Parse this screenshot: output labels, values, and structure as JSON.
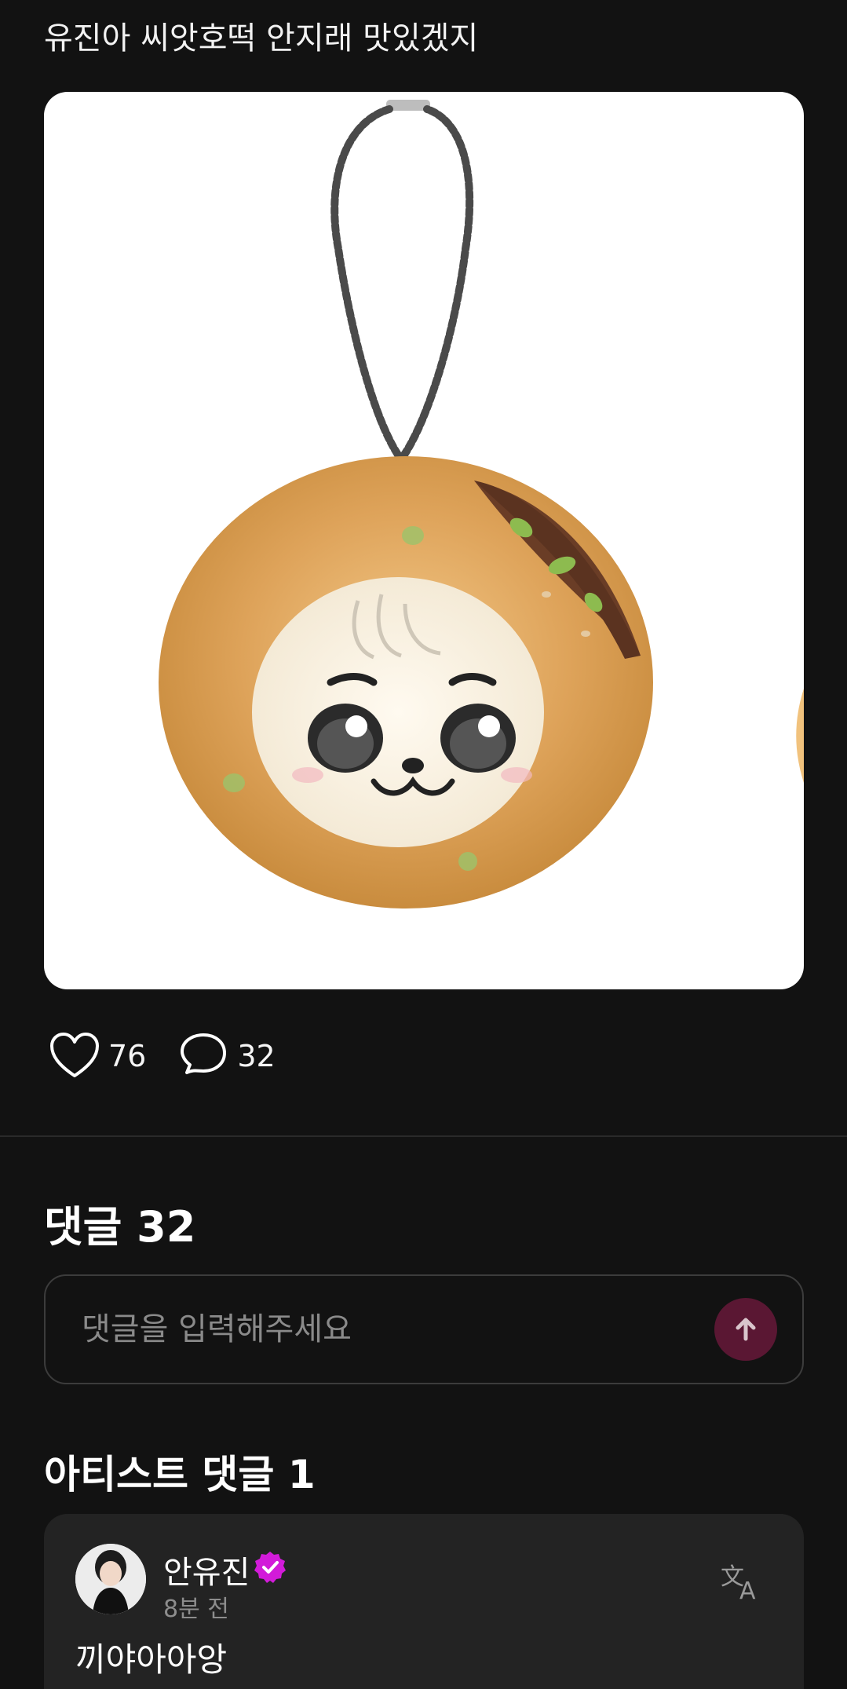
{
  "post": {
    "text": "유진아 씨앗호떡 안지래 맛있겠지",
    "likes": "76",
    "comments": "32"
  },
  "comments_section": {
    "title": "댓글 32",
    "input_placeholder": "댓글을 입력해주세요"
  },
  "artist_section": {
    "title": "아티스트 댓글 1",
    "comment": {
      "author": "안유진",
      "time": "8분 전",
      "text": "끼야아아앙"
    }
  },
  "colors": {
    "background": "#121212",
    "card": "#232323",
    "send_button": "#5a1733",
    "verified_badge": "#d21bd9"
  },
  "icons": [
    "heart-icon",
    "comment-icon",
    "send-arrow-icon",
    "verified-icon",
    "translate-icon"
  ]
}
